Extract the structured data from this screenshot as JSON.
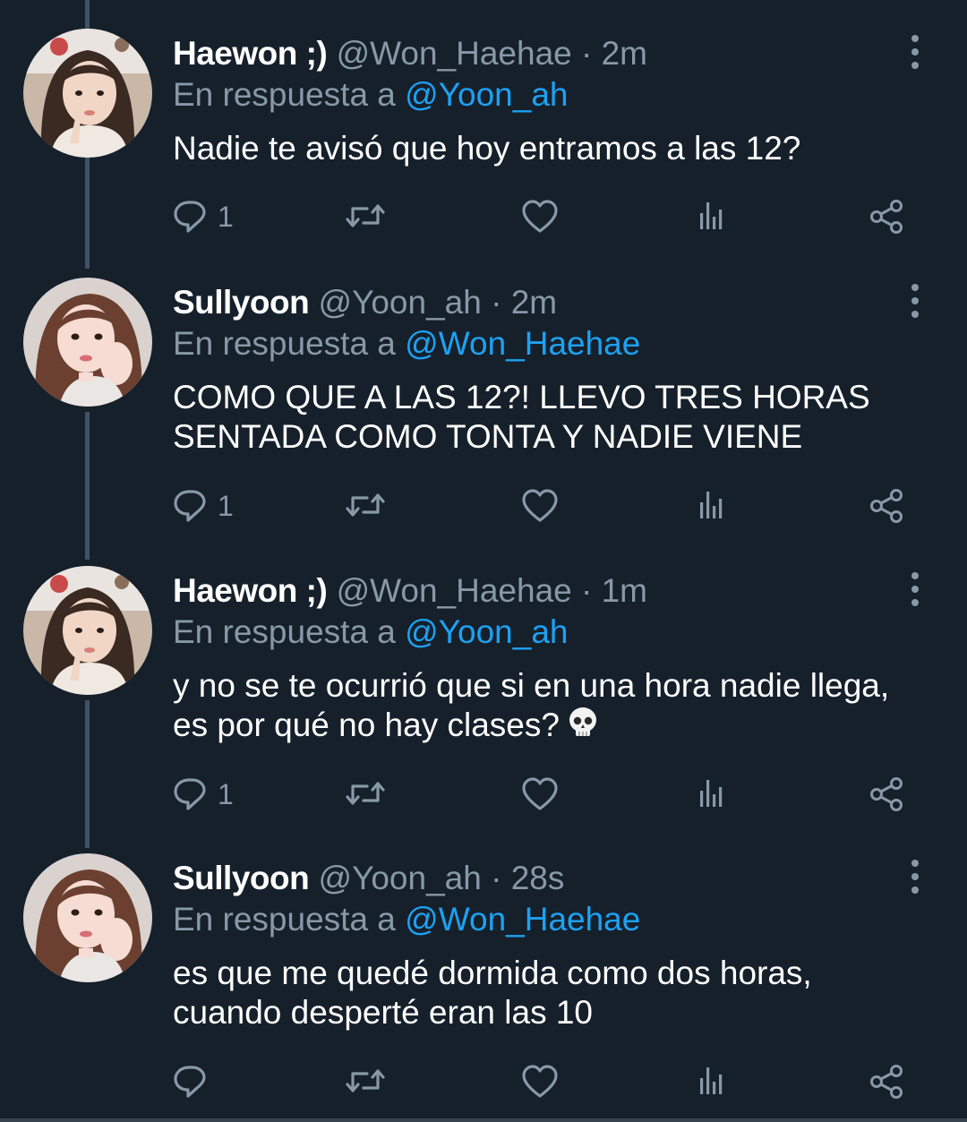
{
  "colors": {
    "background": "#15202b",
    "name_text": "#ffffff",
    "secondary_text": "#8899a6",
    "mention": "#1da1f2",
    "thread_line": "#3d5466"
  },
  "tweets": [
    {
      "name": "Haewon ;)",
      "handle": "@Won_Haehae",
      "separator": "·",
      "time": "2m",
      "reply_prefix": "En respuesta a",
      "reply_to": "@Yoon_ah",
      "text": "Nadie te avisó que hoy entramos a las 12?",
      "reply_count": "1",
      "avatar": "avatar-haewon"
    },
    {
      "name": "Sullyoon",
      "handle": "@Yoon_ah",
      "separator": "·",
      "time": "2m",
      "reply_prefix": "En respuesta a",
      "reply_to": "@Won_Haehae",
      "text": "COMO QUE A LAS 12?! LLEVO TRES HORAS SENTADA COMO TONTA Y NADIE VIENE",
      "reply_count": "1",
      "avatar": "avatar-sullyoon"
    },
    {
      "name": "Haewon ;)",
      "handle": "@Won_Haehae",
      "separator": "·",
      "time": "1m",
      "reply_prefix": "En respuesta a",
      "reply_to": "@Yoon_ah",
      "text": "y no se te ocurrió que si en una hora nadie llega, es por qué no hay clases?",
      "emoji": "skull-emoji",
      "reply_count": "1",
      "avatar": "avatar-haewon"
    },
    {
      "name": "Sullyoon",
      "handle": "@Yoon_ah",
      "separator": "·",
      "time": "28s",
      "reply_prefix": "En respuesta a",
      "reply_to": "@Won_Haehae",
      "text": "es que me quedé dormida como dos horas, cuando desperté eran las 10",
      "reply_count": "",
      "avatar": "avatar-sullyoon"
    }
  ],
  "icons": {
    "reply": "reply-bubble-icon",
    "retweet": "retweet-icon",
    "like": "heart-icon",
    "analytics": "analytics-bars-icon",
    "share": "share-icon",
    "more": "more-vertical-icon"
  }
}
